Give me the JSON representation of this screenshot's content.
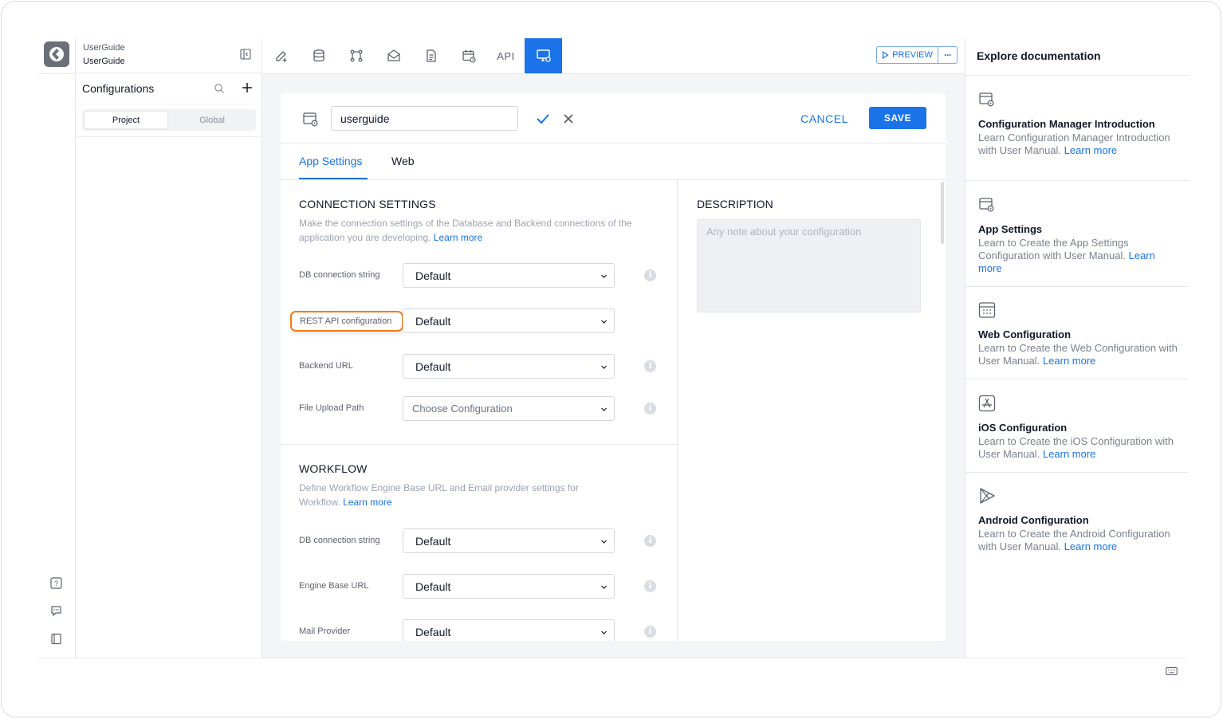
{
  "project": {
    "name_top": "UserGuide",
    "name_bottom": "UserGuide",
    "configs_title": "Configurations",
    "scope_tabs": [
      "Project",
      "Global"
    ]
  },
  "toolbar": {
    "icons": [
      "pencil-add-icon",
      "database-icon",
      "workflow-icon",
      "mail-icon",
      "document-icon",
      "calendar-icon"
    ],
    "api_label": "API",
    "active_icon": "monitor-settings-icon",
    "preview_label": "PREVIEW",
    "more_label": "···"
  },
  "editor": {
    "config_name": "userguide",
    "cancel_label": "CANCEL",
    "save_label": "SAVE",
    "tabs": [
      "App Settings",
      "Web"
    ],
    "connection": {
      "title": "CONNECTION SETTINGS",
      "desc": "Make the connection settings of the Database and Backend connections of the application you are developing.",
      "learn_more": "Learn more",
      "fields": [
        {
          "label": "DB connection string",
          "value": "Default"
        },
        {
          "label": "REST API configuration",
          "value": "Default"
        },
        {
          "label": "Backend URL",
          "value": "Default"
        },
        {
          "label": "File Upload Path",
          "value": "Choose Configuration"
        }
      ]
    },
    "workflow": {
      "title": "WORKFLOW",
      "desc": "Define Workflow Engine Base URL and Email provider settings for Workflow.",
      "learn_more": "Learn more",
      "fields": [
        {
          "label": "DB connection string",
          "value": "Default"
        },
        {
          "label": "Engine Base URL",
          "value": "Default"
        },
        {
          "label": "Mail Provider",
          "value": "Default"
        }
      ]
    },
    "description": {
      "title": "DESCRIPTION",
      "placeholder": "Any note about your configuration"
    }
  },
  "docs": {
    "title": "Explore documentation",
    "items": [
      {
        "icon": "config-manager-icon",
        "title": "Configuration Manager Introduction",
        "desc": "Learn Configuration Manager Introduction with User Manual.",
        "link": "Learn more"
      },
      {
        "icon": "app-settings-icon",
        "title": "App Settings",
        "desc": "Learn to Create the App Settings Configuration with User Manual.",
        "link": "Learn more"
      },
      {
        "icon": "web-config-icon",
        "title": "Web Configuration",
        "desc": "Learn to Create the Web Configuration with User Manual.",
        "link": "Learn more"
      },
      {
        "icon": "ios-appstore-icon",
        "title": "iOS Configuration",
        "desc": "Learn to Create the iOS Configuration with User Manual.",
        "link": "Learn more"
      },
      {
        "icon": "android-play-icon",
        "title": "Android Configuration",
        "desc": "Learn to Create the Android Configuration with User Manual.",
        "link": "Learn more"
      }
    ]
  },
  "colors": {
    "accent": "#1a73e8",
    "highlight": "#f07c16"
  }
}
